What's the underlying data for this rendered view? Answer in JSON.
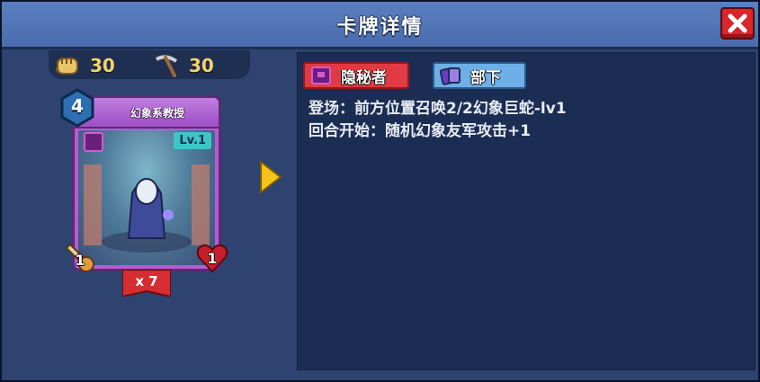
{
  "header": {
    "title": "卡牌详情"
  },
  "resources": {
    "fist_count": "30",
    "pickaxe_count": "30"
  },
  "card": {
    "name": "幻象系教授",
    "cost": "4",
    "level": "Lv.1",
    "attack": "1",
    "health": "1",
    "count": "x 7"
  },
  "tags": [
    {
      "label": "隐秘者",
      "color": "#e23a42"
    },
    {
      "label": "部下",
      "color": "#6dafe6"
    }
  ],
  "description": [
    "登场：前方位置召唤2/2幻象巨蛇-lv1",
    "回合开始：随机幻象友军攻击+1"
  ],
  "icons": {
    "close": "close-icon",
    "fist": "fist-icon",
    "pickaxe": "pickaxe-icon",
    "arrow": "arrow-right-icon"
  }
}
